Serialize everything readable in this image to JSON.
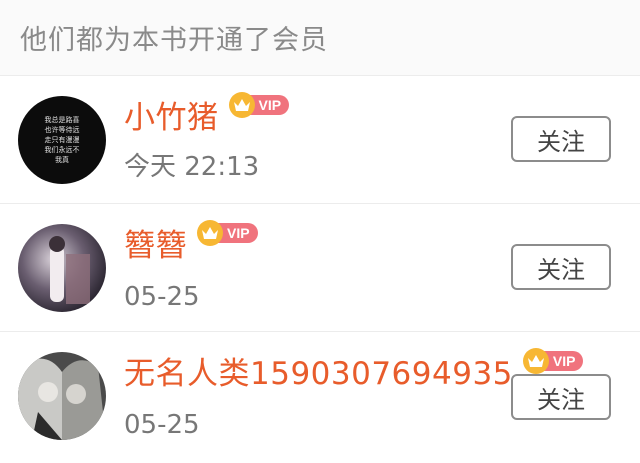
{
  "header": {
    "title": "他们都为本书开通了会员"
  },
  "vip_badge_text": "VIP",
  "follow_label": "关注",
  "members": [
    {
      "name": "小竹猪",
      "time": "今天 22:13"
    },
    {
      "name": "簪簪",
      "time": "05-25"
    },
    {
      "name": "无名人类1590307694935",
      "time": "05-25"
    }
  ],
  "avatar_text": [
    "我总是路喜",
    "也许等待远",
    "走只有漫漫",
    "我们永远不",
    "我真"
  ]
}
